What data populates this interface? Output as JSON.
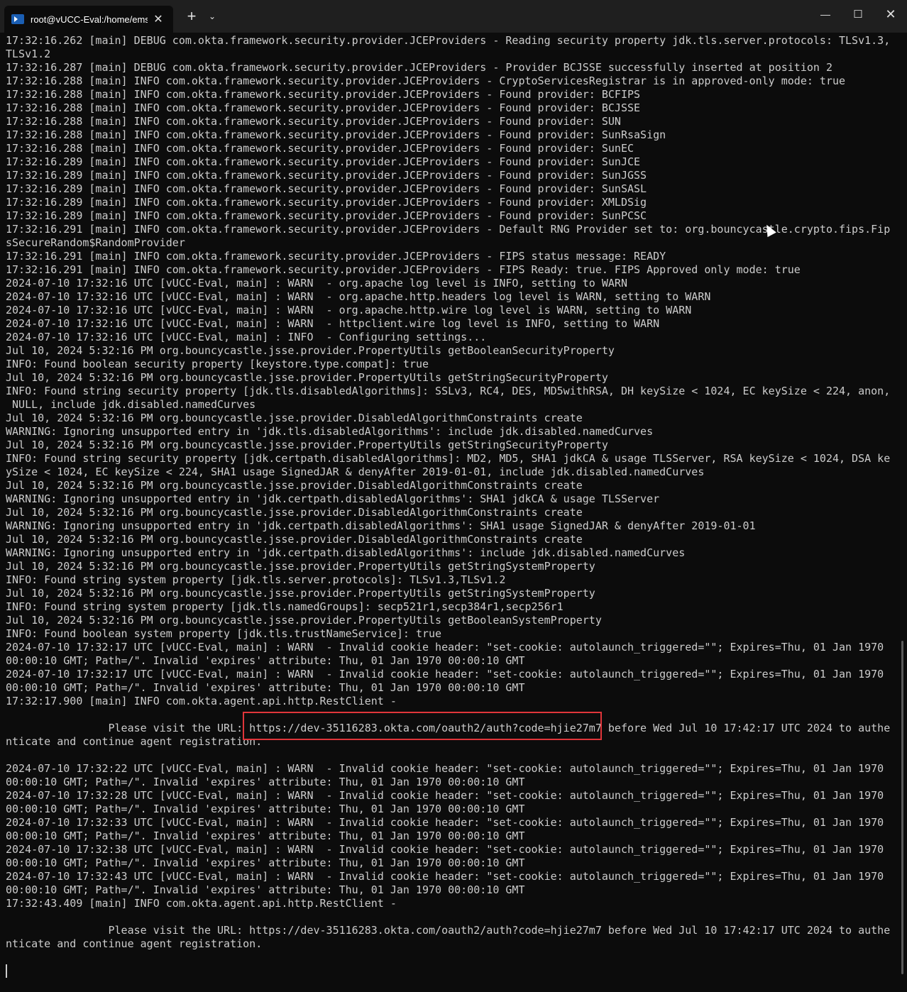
{
  "window": {
    "tab_title": "root@vUCC-Eval:/home/emsa",
    "tab_close": "✕",
    "new_tab": "+",
    "dropdown": "⌄",
    "minimize": "—",
    "maximize": "☐",
    "close": "✕"
  },
  "terminal": {
    "lines": [
      "17:32:16.262 [main] DEBUG com.okta.framework.security.provider.JCEProviders - Reading security property jdk.tls.server.protocols: TLSv1.3,",
      "TLSv1.2",
      "17:32:16.287 [main] DEBUG com.okta.framework.security.provider.JCEProviders - Provider BCJSSE successfully inserted at position 2",
      "17:32:16.288 [main] INFO com.okta.framework.security.provider.JCEProviders - CryptoServicesRegistrar is in approved-only mode: true",
      "17:32:16.288 [main] INFO com.okta.framework.security.provider.JCEProviders - Found provider: BCFIPS",
      "17:32:16.288 [main] INFO com.okta.framework.security.provider.JCEProviders - Found provider: BCJSSE",
      "17:32:16.288 [main] INFO com.okta.framework.security.provider.JCEProviders - Found provider: SUN",
      "17:32:16.288 [main] INFO com.okta.framework.security.provider.JCEProviders - Found provider: SunRsaSign",
      "17:32:16.288 [main] INFO com.okta.framework.security.provider.JCEProviders - Found provider: SunEC",
      "17:32:16.289 [main] INFO com.okta.framework.security.provider.JCEProviders - Found provider: SunJCE",
      "17:32:16.289 [main] INFO com.okta.framework.security.provider.JCEProviders - Found provider: SunJGSS",
      "17:32:16.289 [main] INFO com.okta.framework.security.provider.JCEProviders - Found provider: SunSASL",
      "17:32:16.289 [main] INFO com.okta.framework.security.provider.JCEProviders - Found provider: XMLDSig",
      "17:32:16.289 [main] INFO com.okta.framework.security.provider.JCEProviders - Found provider: SunPCSC",
      "17:32:16.291 [main] INFO com.okta.framework.security.provider.JCEProviders - Default RNG Provider set to: org.bouncycastle.crypto.fips.Fip",
      "sSecureRandom$RandomProvider",
      "17:32:16.291 [main] INFO com.okta.framework.security.provider.JCEProviders - FIPS status message: READY",
      "17:32:16.291 [main] INFO com.okta.framework.security.provider.JCEProviders - FIPS Ready: true. FIPS Approved only mode: true",
      "2024-07-10 17:32:16 UTC [vUCC-Eval, main] : WARN  - org.apache log level is INFO, setting to WARN",
      "2024-07-10 17:32:16 UTC [vUCC-Eval, main] : WARN  - org.apache.http.headers log level is WARN, setting to WARN",
      "2024-07-10 17:32:16 UTC [vUCC-Eval, main] : WARN  - org.apache.http.wire log level is WARN, setting to WARN",
      "2024-07-10 17:32:16 UTC [vUCC-Eval, main] : WARN  - httpclient.wire log level is INFO, setting to WARN",
      "2024-07-10 17:32:16 UTC [vUCC-Eval, main] : INFO  - Configuring settings...",
      "Jul 10, 2024 5:32:16 PM org.bouncycastle.jsse.provider.PropertyUtils getBooleanSecurityProperty",
      "INFO: Found boolean security property [keystore.type.compat]: true",
      "Jul 10, 2024 5:32:16 PM org.bouncycastle.jsse.provider.PropertyUtils getStringSecurityProperty",
      "INFO: Found string security property [jdk.tls.disabledAlgorithms]: SSLv3, RC4, DES, MD5withRSA, DH keySize < 1024, EC keySize < 224, anon,",
      " NULL, include jdk.disabled.namedCurves",
      "Jul 10, 2024 5:32:16 PM org.bouncycastle.jsse.provider.DisabledAlgorithmConstraints create",
      "WARNING: Ignoring unsupported entry in 'jdk.tls.disabledAlgorithms': include jdk.disabled.namedCurves",
      "Jul 10, 2024 5:32:16 PM org.bouncycastle.jsse.provider.PropertyUtils getStringSecurityProperty",
      "INFO: Found string security property [jdk.certpath.disabledAlgorithms]: MD2, MD5, SHA1 jdkCA & usage TLSServer, RSA keySize < 1024, DSA ke",
      "ySize < 1024, EC keySize < 224, SHA1 usage SignedJAR & denyAfter 2019-01-01, include jdk.disabled.namedCurves",
      "Jul 10, 2024 5:32:16 PM org.bouncycastle.jsse.provider.DisabledAlgorithmConstraints create",
      "WARNING: Ignoring unsupported entry in 'jdk.certpath.disabledAlgorithms': SHA1 jdkCA & usage TLSServer",
      "Jul 10, 2024 5:32:16 PM org.bouncycastle.jsse.provider.DisabledAlgorithmConstraints create",
      "WARNING: Ignoring unsupported entry in 'jdk.certpath.disabledAlgorithms': SHA1 usage SignedJAR & denyAfter 2019-01-01",
      "Jul 10, 2024 5:32:16 PM org.bouncycastle.jsse.provider.DisabledAlgorithmConstraints create",
      "WARNING: Ignoring unsupported entry in 'jdk.certpath.disabledAlgorithms': include jdk.disabled.namedCurves",
      "Jul 10, 2024 5:32:16 PM org.bouncycastle.jsse.provider.PropertyUtils getStringSystemProperty",
      "INFO: Found string system property [jdk.tls.server.protocols]: TLSv1.3,TLSv1.2",
      "Jul 10, 2024 5:32:16 PM org.bouncycastle.jsse.provider.PropertyUtils getStringSystemProperty",
      "INFO: Found string system property [jdk.tls.namedGroups]: secp521r1,secp384r1,secp256r1",
      "Jul 10, 2024 5:32:16 PM org.bouncycastle.jsse.provider.PropertyUtils getBooleanSystemProperty",
      "INFO: Found boolean system property [jdk.tls.trustNameService]: true",
      "2024-07-10 17:32:17 UTC [vUCC-Eval, main] : WARN  - Invalid cookie header: \"set-cookie: autolaunch_triggered=\"\"; Expires=Thu, 01 Jan 1970",
      "00:00:10 GMT; Path=/\". Invalid 'expires' attribute: Thu, 01 Jan 1970 00:00:10 GMT",
      "2024-07-10 17:32:17 UTC [vUCC-Eval, main] : WARN  - Invalid cookie header: \"set-cookie: autolaunch_triggered=\"\"; Expires=Thu, 01 Jan 1970",
      "00:00:10 GMT; Path=/\". Invalid 'expires' attribute: Thu, 01 Jan 1970 00:00:10 GMT",
      "17:32:17.900 [main] INFO com.okta.agent.api.http.RestClient -",
      "",
      "                Please visit the URL: https://dev-35116283.okta.com/oauth2/auth?code=hjie27m7 before Wed Jul 10 17:42:17 UTC 2024 to authe",
      "nticate and continue agent registration.",
      "",
      "2024-07-10 17:32:22 UTC [vUCC-Eval, main] : WARN  - Invalid cookie header: \"set-cookie: autolaunch_triggered=\"\"; Expires=Thu, 01 Jan 1970",
      "00:00:10 GMT; Path=/\". Invalid 'expires' attribute: Thu, 01 Jan 1970 00:00:10 GMT",
      "2024-07-10 17:32:28 UTC [vUCC-Eval, main] : WARN  - Invalid cookie header: \"set-cookie: autolaunch_triggered=\"\"; Expires=Thu, 01 Jan 1970",
      "00:00:10 GMT; Path=/\". Invalid 'expires' attribute: Thu, 01 Jan 1970 00:00:10 GMT",
      "2024-07-10 17:32:33 UTC [vUCC-Eval, main] : WARN  - Invalid cookie header: \"set-cookie: autolaunch_triggered=\"\"; Expires=Thu, 01 Jan 1970",
      "00:00:10 GMT; Path=/\". Invalid 'expires' attribute: Thu, 01 Jan 1970 00:00:10 GMT",
      "2024-07-10 17:32:38 UTC [vUCC-Eval, main] : WARN  - Invalid cookie header: \"set-cookie: autolaunch_triggered=\"\"; Expires=Thu, 01 Jan 1970",
      "00:00:10 GMT; Path=/\". Invalid 'expires' attribute: Thu, 01 Jan 1970 00:00:10 GMT",
      "2024-07-10 17:32:43 UTC [vUCC-Eval, main] : WARN  - Invalid cookie header: \"set-cookie: autolaunch_triggered=\"\"; Expires=Thu, 01 Jan 1970",
      "00:00:10 GMT; Path=/\". Invalid 'expires' attribute: Thu, 01 Jan 1970 00:00:10 GMT",
      "17:32:43.409 [main] INFO com.okta.agent.api.http.RestClient -",
      "",
      "                Please visit the URL: https://dev-35116283.okta.com/oauth2/auth?code=hjie27m7 before Wed Jul 10 17:42:17 UTC 2024 to authe",
      "nticate and continue agent registration."
    ]
  }
}
